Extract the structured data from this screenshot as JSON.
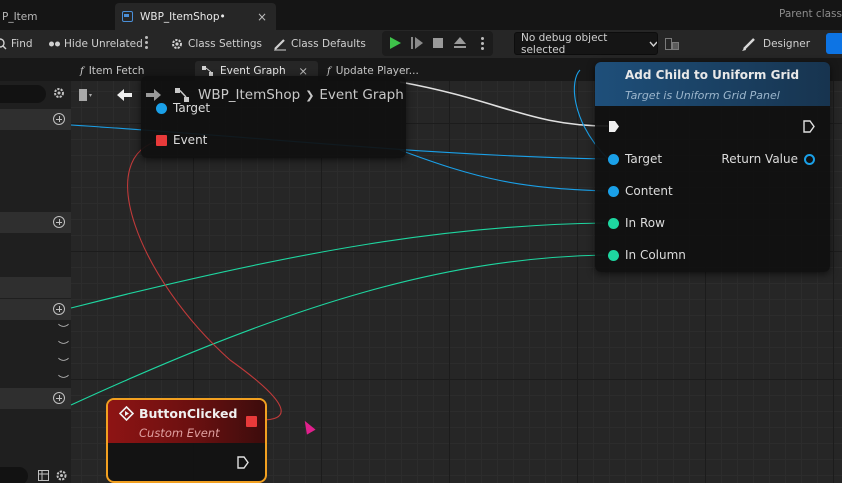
{
  "tabs": {
    "item_tab": "P_Item",
    "active_tab": "WBP_ItemShop•",
    "close_symbol": "×",
    "parent_class": "Parent class"
  },
  "toolbar": {
    "find": "Find",
    "hide_unrelated": "Hide Unrelated",
    "class_settings": "Class Settings",
    "class_defaults": "Class Defaults",
    "debug_object": "No debug object selected",
    "designer": "Designer"
  },
  "graph_tabs": {
    "item_fetch": "Item Fetch",
    "event_graph": "Event Graph",
    "update_player": "Update Player...",
    "close_symbol": "×"
  },
  "breadcrumb": {
    "root": "WBP_ItemShop",
    "separator": "❯",
    "current": "Event Graph"
  },
  "nodes": {
    "bind_node": {
      "target_pin": "Target",
      "event_pin": "Event"
    },
    "add_child": {
      "title": "Add Child to Uniform Grid",
      "subtitle": "Target is Uniform Grid Panel",
      "pins": {
        "target": "Target",
        "return_value": "Return Value",
        "content": "Content",
        "in_row": "In Row",
        "in_column": "In Column"
      }
    },
    "custom_event": {
      "title": "ButtonClicked",
      "subtitle": "Custom Event"
    }
  },
  "colors": {
    "object_pin": "#1aa0e8",
    "int_pin": "#1ed6a0",
    "delegate_pin": "#e83a3a",
    "custom_event_border": "#f2a020",
    "play_green": "#3ec24a",
    "accent_blue": "#0d74e4"
  },
  "icons": [
    "blueprint-icon",
    "search-icon",
    "filter-icon",
    "gear-icon",
    "pencil-icon",
    "play-icon",
    "pause-icon",
    "stop-icon",
    "eject-icon",
    "chevron-down-icon",
    "back-arrow-icon",
    "forward-arrow-icon",
    "graph-icon",
    "bookmark-icon",
    "plus-circle-icon",
    "function-icon",
    "exec-pin-icon",
    "cursor-icon"
  ]
}
